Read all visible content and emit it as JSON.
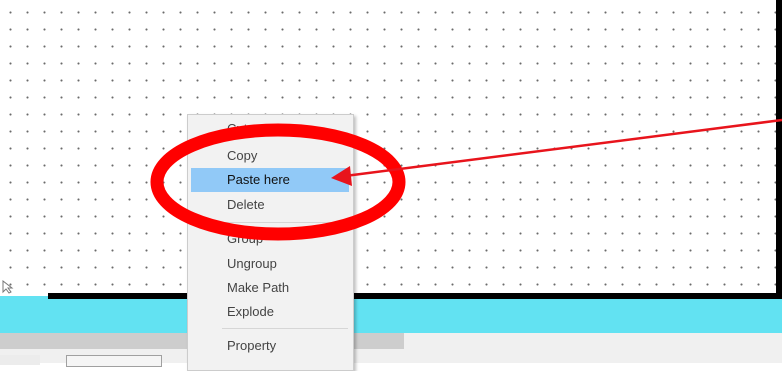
{
  "context_menu": {
    "items": [
      {
        "label": "Cut",
        "active": false
      },
      {
        "label": "Copy",
        "active": false
      },
      {
        "label": "Paste here",
        "active": true
      },
      {
        "label": "Delete",
        "active": false
      },
      {
        "label": "Group",
        "active": false
      },
      {
        "label": "Ungroup",
        "active": false
      },
      {
        "label": "Make Path",
        "active": false
      },
      {
        "label": "Explode",
        "active": false
      },
      {
        "label": "Property",
        "active": false
      }
    ]
  },
  "annotation": {
    "ellipse_color": "#ff0000",
    "arrow_color": "#e8141c",
    "highlight_color": "#91c9f7",
    "canvas_bar_color": "#62e2f2"
  }
}
